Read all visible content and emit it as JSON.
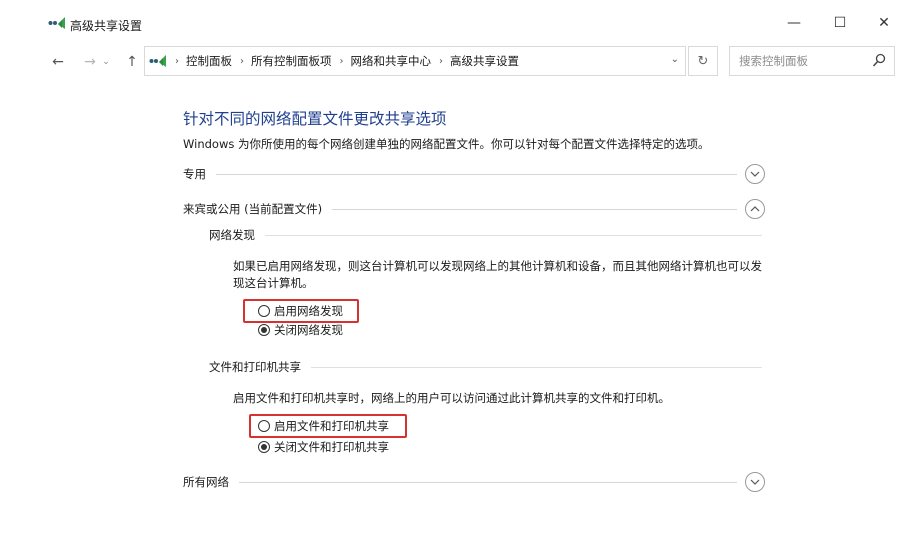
{
  "window": {
    "title": "高级共享设置",
    "controls": {
      "minimize": "—",
      "maximize": "☐",
      "close": "✕"
    }
  },
  "nav": {
    "back": "←",
    "forward": "→",
    "history": "⌄",
    "up": "↑",
    "breadcrumb": [
      "控制面板",
      "所有控制面板项",
      "网络和共享中心",
      "高级共享设置"
    ],
    "separator": "›",
    "dropdown": "⌄",
    "refresh": "↻"
  },
  "search": {
    "placeholder": "搜索控制面板"
  },
  "content": {
    "heading": "针对不同的网络配置文件更改共享选项",
    "description": "Windows 为你所使用的每个网络创建单独的网络配置文件。你可以针对每个配置文件选择特定的选项。",
    "sections": {
      "private": {
        "label": "专用",
        "state": "collapsed"
      },
      "guest_public": {
        "label": "来宾或公用 (当前配置文件)",
        "state": "expanded"
      },
      "all_networks": {
        "label": "所有网络",
        "state": "collapsed"
      }
    },
    "network_discovery": {
      "title": "网络发现",
      "description": "如果已启用网络发现，则这台计算机可以发现网络上的其他计算机和设备，而且其他网络计算机也可以发现这台计算机。",
      "options": [
        "启用网络发现",
        "关闭网络发现"
      ],
      "selected": "关闭网络发现"
    },
    "file_printer_sharing": {
      "title": "文件和打印机共享",
      "description": "启用文件和打印机共享时，网络上的用户可以访问通过此计算机共享的文件和打印机。",
      "options": [
        "启用文件和打印机共享",
        "关闭文件和打印机共享"
      ],
      "selected": "关闭文件和打印机共享"
    }
  },
  "colors": {
    "heading": "#1f3f8f",
    "highlight": "#d63232",
    "icon_green": "#3aa04a",
    "icon_dark": "#2b5d78"
  },
  "icons": {
    "app": "network-sharing-icon",
    "search": "magnifier-icon",
    "chevron_down": "chevron-down-circle-icon",
    "chevron_up": "chevron-up-circle-icon"
  }
}
